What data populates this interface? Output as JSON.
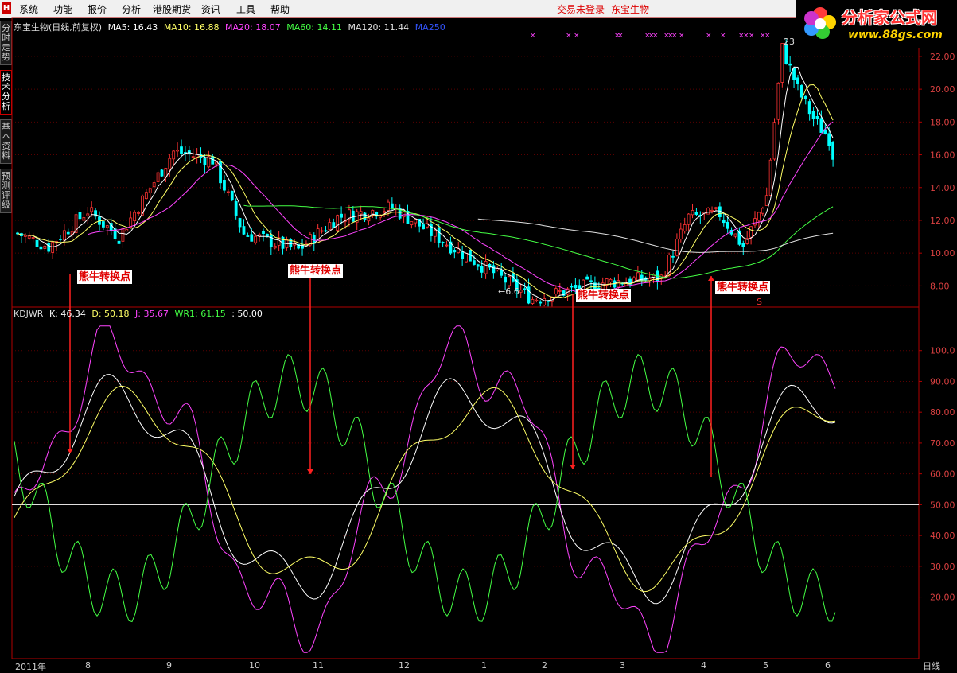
{
  "menu": {
    "items": [
      "系统",
      "功能",
      "报价",
      "分析",
      "港股期货",
      "资讯",
      "工具",
      "帮助"
    ],
    "login_status": "交易未登录",
    "stock_title": "东宝生物"
  },
  "brand": {
    "name": "分析家公式网",
    "url": "www.88gs.com"
  },
  "sidebar": {
    "tabs": [
      {
        "label": "分时走势",
        "active": false
      },
      {
        "label": "技术分析",
        "active": true
      },
      {
        "label": "基本资料",
        "active": false
      },
      {
        "label": "预测评级",
        "active": false
      }
    ]
  },
  "main_chart": {
    "title": "东宝生物(日线,前复权)",
    "ma": [
      {
        "label": "MA5: 16.43",
        "color": "#ffffff"
      },
      {
        "label": "MA10: 16.88",
        "color": "#ffff66"
      },
      {
        "label": "MA20: 18.07",
        "color": "#ff44ff"
      },
      {
        "label": "MA60: 14.11",
        "color": "#44ff44"
      },
      {
        "label": "MA120: 11.44",
        "color": "#e0e0e0"
      },
      {
        "label": "MA250",
        "color": "#3355ff"
      }
    ],
    "price_axis": [
      "22.00",
      "20.00",
      "18.00",
      "16.00",
      "14.00",
      "12.00",
      "10.00",
      "8.00"
    ],
    "high_label": "23.08",
    "low_label": "6.6",
    "marker_s": "S",
    "ylim": [
      7,
      23.5
    ]
  },
  "kdj": {
    "title": "KDJWR",
    "values": [
      {
        "label": "K: 46.34",
        "color": "#ffffff"
      },
      {
        "label": "D: 50.18",
        "color": "#ffff66"
      },
      {
        "label": "J: 35.67",
        "color": "#ff44ff"
      },
      {
        "label": "WR1: 61.15",
        "color": "#44ff44"
      },
      {
        "label": ": 50.00",
        "color": "#ffffff"
      }
    ],
    "axis": [
      "100.0",
      "90.00",
      "80.00",
      "70.00",
      "60.00",
      "50.00",
      "40.00",
      "30.00",
      "20.00"
    ],
    "ylim": [
      0,
      110
    ]
  },
  "annotations": [
    "熊牛转换点",
    "熊牛转换点",
    "熊牛转换点",
    "熊牛转换点"
  ],
  "date_axis": [
    "2011年",
    "8",
    "9",
    "10",
    "11",
    "12",
    "1",
    "2",
    "3",
    "4",
    "5",
    "6"
  ],
  "period": "日线",
  "colors": {
    "up": "#ff3333",
    "down": "#00ffff",
    "frame": "#b00000"
  }
}
